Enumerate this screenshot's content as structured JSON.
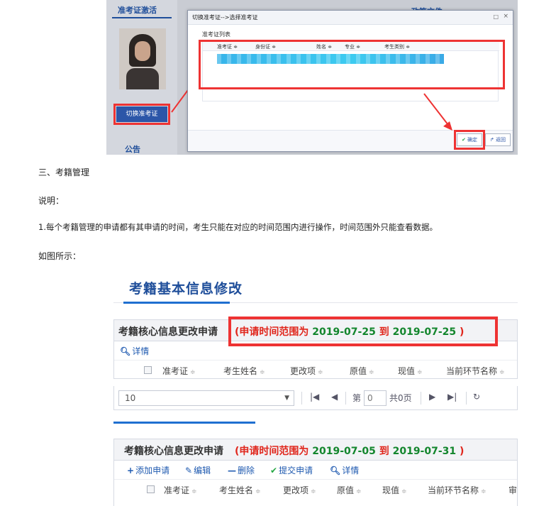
{
  "shot1": {
    "tab_activate": "准考证激活",
    "policy_tab": "政策文件",
    "switch_button": "切换准考证",
    "notice_tab": "公告",
    "dialog": {
      "title": "切换准考证-->选择准考证",
      "max_icon": "□",
      "close_icon": "×",
      "list_label": "准考证列表",
      "columns": [
        "准考证 ≑",
        "身份证 ≑",
        "姓名 ≑",
        "专业 ≑",
        "考生类别 ≑"
      ],
      "ok_button": "确定",
      "back_button": "返回"
    }
  },
  "text": {
    "section_heading": "三、考籍管理",
    "note_label": "说明：",
    "point1": "1.每个考籍管理的申请都有其申请的时间，考生只能在对应的时间范围内进行操作，时间范围外只能查看数据。",
    "as_shown": "如图所示："
  },
  "shot2": {
    "page_title": "考籍基本信息修改",
    "panel1": {
      "name": "考籍核心信息更改申请",
      "range_prefix": "(申请时间范围为",
      "start": "2019-07-25",
      "to": "到",
      "end": "2019-07-25",
      "range_suffix": ")",
      "detail_button": "详情",
      "columns": [
        "准考证",
        "考生姓名",
        "更改项",
        "原值",
        "现值",
        "当前环节名称"
      ]
    },
    "pager": {
      "page_size": "10",
      "page_prefix": "第",
      "page_value": "0",
      "page_total": "共0页"
    },
    "panel2": {
      "name": "考籍核心信息更改申请",
      "range_prefix": "(申请时间范围为",
      "start": "2019-07-05",
      "to": "到",
      "end": "2019-07-31",
      "range_suffix": ")",
      "add_button": "添加申请",
      "edit_button": "编辑",
      "delete_button": "删除",
      "submit_button": "提交申请",
      "detail_button": "详情",
      "columns": [
        "准考证",
        "考生姓名",
        "更改项",
        "原值",
        "现值",
        "当前环节名称",
        "审"
      ]
    }
  },
  "colors": {
    "highlight_red": "#e33333",
    "brand_blue": "#1f4e9a",
    "date_green": "#13862d"
  },
  "icons": [
    "search-icon",
    "plus-icon",
    "pencil-icon",
    "minus-icon",
    "check-icon",
    "first-page-icon",
    "prev-page-icon",
    "next-page-icon",
    "last-page-icon",
    "refresh-icon",
    "sort-icon",
    "dropdown-arrow-icon"
  ]
}
